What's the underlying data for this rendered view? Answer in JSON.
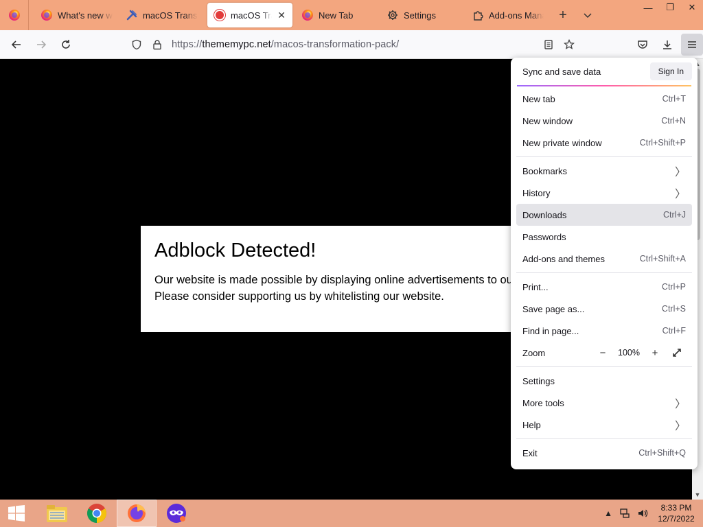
{
  "tabs": [
    {
      "label": "What's new wit",
      "icon": "firefox-icon",
      "active": false
    },
    {
      "label": "macOS Transfo",
      "icon": "tools-icon",
      "active": false
    },
    {
      "label": "macOS Trans",
      "icon": "site-icon",
      "active": true
    },
    {
      "label": "New Tab",
      "icon": "firefox-icon",
      "active": false
    },
    {
      "label": "Settings",
      "icon": "gear-icon",
      "active": false
    },
    {
      "label": "Add-ons Mana",
      "icon": "puzzle-icon",
      "active": false
    }
  ],
  "navbar": {
    "url_host": "thememypc.net",
    "url_prefix": "https://",
    "url_path": "/macos-transformation-pack/"
  },
  "page": {
    "heading": "Adblock Detected!",
    "line1": "Our website is made possible by displaying online advertisements to our visitors.",
    "line2": "Please consider supporting us by whitelisting our website."
  },
  "appmenu": {
    "sync_title": "Sync and save data",
    "signin_label": "Sign In",
    "items": [
      {
        "label": "New tab",
        "shortcut": "Ctrl+T"
      },
      {
        "label": "New window",
        "shortcut": "Ctrl+N"
      },
      {
        "label": "New private window",
        "shortcut": "Ctrl+Shift+P"
      },
      {
        "label": "Bookmarks"
      },
      {
        "label": "History"
      },
      {
        "label": "Downloads",
        "shortcut": "Ctrl+J"
      },
      {
        "label": "Passwords"
      },
      {
        "label": "Add-ons and themes",
        "shortcut": "Ctrl+Shift+A"
      },
      {
        "label": "Print...",
        "shortcut": "Ctrl+P"
      },
      {
        "label": "Save page as...",
        "shortcut": "Ctrl+S"
      },
      {
        "label": "Find in page...",
        "shortcut": "Ctrl+F"
      },
      {
        "label": "Zoom"
      },
      {
        "label": "Settings"
      },
      {
        "label": "More tools"
      },
      {
        "label": "Help"
      },
      {
        "label": "Exit",
        "shortcut": "Ctrl+Shift+Q"
      }
    ],
    "zoom_value": "100%"
  },
  "taskbar": {
    "time": "8:33 PM",
    "date": "12/7/2022"
  },
  "colors": {
    "tabstrip": "#f3a67f",
    "taskbar": "#e9a588",
    "menu_hover": "#e4e4e8"
  }
}
